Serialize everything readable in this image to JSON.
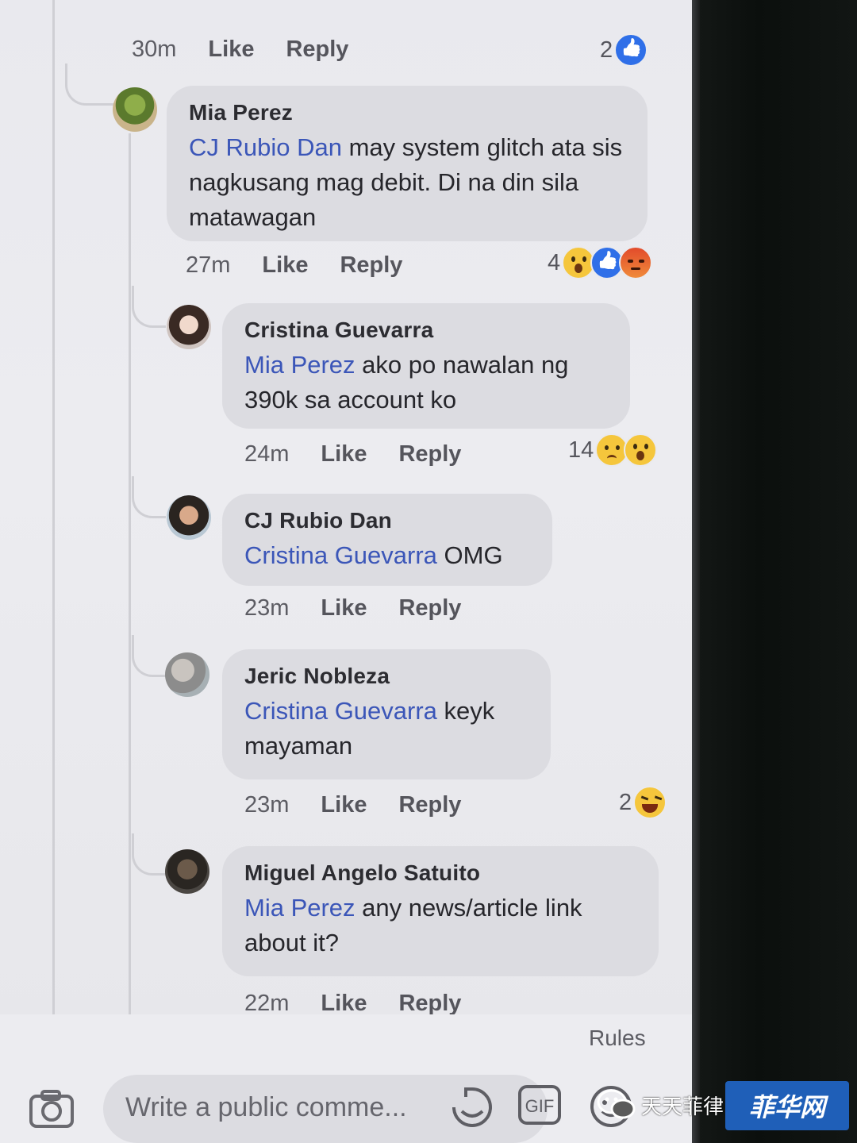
{
  "comments": [
    {
      "meta": {
        "time": "30m",
        "like": "Like",
        "reply": "Reply"
      },
      "reaction_count": "2",
      "reactions": [
        "like"
      ]
    },
    {
      "name": "Mia Perez",
      "mention": "CJ Rubio Dan",
      "text": " may system glitch ata sis nagkusang mag debit. Di na din sila matawagan",
      "meta": {
        "time": "27m",
        "like": "Like",
        "reply": "Reply"
      },
      "reaction_count": "4",
      "reactions": [
        "wow",
        "like",
        "angry"
      ]
    },
    {
      "name": "Cristina Guevarra",
      "mention": "Mia Perez",
      "text": "  ako po nawalan ng 390k sa account ko",
      "meta": {
        "time": "24m",
        "like": "Like",
        "reply": "Reply"
      },
      "reaction_count": "14",
      "reactions": [
        "sad",
        "wow"
      ]
    },
    {
      "name": "CJ Rubio Dan",
      "mention": "Cristina Guevarra",
      "text": " OMG",
      "meta": {
        "time": "23m",
        "like": "Like",
        "reply": "Reply"
      }
    },
    {
      "name": "Jeric Nobleza",
      "mention": "Cristina Guevarra",
      "text": " keyk mayaman",
      "meta": {
        "time": "23m",
        "like": "Like",
        "reply": "Reply"
      },
      "reaction_count": "2",
      "reactions": [
        "haha"
      ]
    },
    {
      "name": "Miguel Angelo Satuito",
      "mention": "Mia Perez",
      "text": " any news/article link about it?",
      "meta": {
        "time": "22m",
        "like": "Like",
        "reply": "Reply"
      }
    }
  ],
  "rules_label": "Rules",
  "composer": {
    "placeholder": "Write a public comme...",
    "gif_label": "GIF"
  },
  "watermark": {
    "text": "天天菲律",
    "badge": "菲华网"
  },
  "colors": {
    "mention": "#3b56b8",
    "like_blue": "#2f6fe8",
    "bubble": "#dcdce1"
  }
}
